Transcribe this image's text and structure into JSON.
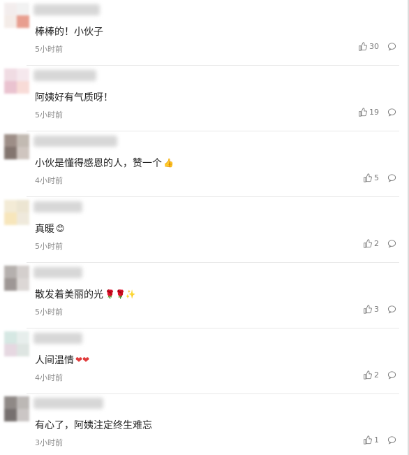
{
  "comments": [
    {
      "text": "棒棒的！小伙子",
      "emoji": "",
      "time": "5小时前",
      "likes": "30",
      "avatar_colors": [
        "#f2ebeb",
        "#f0f0f0",
        "#f3e9e4",
        "#e48e7c"
      ],
      "name_width": 95
    },
    {
      "text": "阿姨好有气质呀！",
      "emoji": "",
      "time": "5小时前",
      "likes": "19",
      "avatar_colors": [
        "#eed6df",
        "#f4e4ea",
        "#e7b9c8",
        "#f7d5d1"
      ],
      "name_width": 90
    },
    {
      "text": "小伙是懂得感恩的人，赞一个",
      "emoji": "👍",
      "time": "4小时前",
      "likes": "5",
      "avatar_colors": [
        "#8d7b73",
        "#b8aea5",
        "#6e5e57",
        "#c7bcb5"
      ],
      "name_width": 120
    },
    {
      "text": "真暖",
      "emoji": "😊",
      "time": "5小时前",
      "likes": "2",
      "avatar_colors": [
        "#f1e8cf",
        "#e9e1cb",
        "#f6e2b0",
        "#ede6d6"
      ],
      "name_width": 70
    },
    {
      "text": "散发着美丽的光",
      "emoji": "🌹🌹✨",
      "time": "5小时前",
      "likes": "3",
      "avatar_colors": [
        "#a9a3a0",
        "#cdc7c5",
        "#8e8683",
        "#d6d1ce"
      ],
      "name_width": 70
    },
    {
      "text": "人间温情",
      "emoji": "❤❤",
      "time": "4小时前",
      "likes": "2",
      "avatar_colors": [
        "#cfe4df",
        "#e3ece9",
        "#e2d2dc",
        "#d9e1dd"
      ],
      "name_width": 70
    },
    {
      "text": "有心了，阿姨注定终生难忘",
      "emoji": "",
      "time": "3小时前",
      "likes": "1",
      "avatar_colors": [
        "#7c7572",
        "#b1aca9",
        "#5f5856",
        "#c2bdbb"
      ],
      "name_width": 100
    }
  ]
}
